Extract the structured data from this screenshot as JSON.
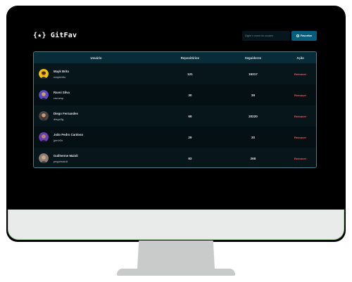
{
  "header": {
    "logo_text": "{★} GitFav",
    "search_placeholder": "Digite o nome do usuário",
    "fav_button_label": "Favoritar"
  },
  "table": {
    "columns": [
      "Usuário",
      "Repositórios",
      "Seguidores",
      "Ação"
    ],
    "rows": [
      {
        "name": "Mayk Brito",
        "login": "maykbrito",
        "repos": "121",
        "followers": "15317",
        "action": "Remover",
        "avatar_color": "#f2c200"
      },
      {
        "name": "Ravni Silva",
        "login": "ravnesp",
        "repos": "30",
        "followers": "39",
        "action": "Remover",
        "avatar_color": "#5b4ab8"
      },
      {
        "name": "Diego Fernandes",
        "login": "diego3g",
        "repos": "69",
        "followers": "20220",
        "action": "Remover",
        "avatar_color": "#7a6a60"
      },
      {
        "name": "João Pedro Cardoso",
        "login": "jpedr3o",
        "repos": "29",
        "followers": "30",
        "action": "Remover",
        "avatar_color": "#6a3fb0"
      },
      {
        "name": "Guilherme Maioli",
        "login": "peguimaioli",
        "repos": "83",
        "followers": "268",
        "action": "Remover",
        "avatar_color": "#8a8078"
      }
    ]
  },
  "colors": {
    "accent": "#065e7c",
    "remove": "#f75a68",
    "header_row": "#092d38"
  }
}
